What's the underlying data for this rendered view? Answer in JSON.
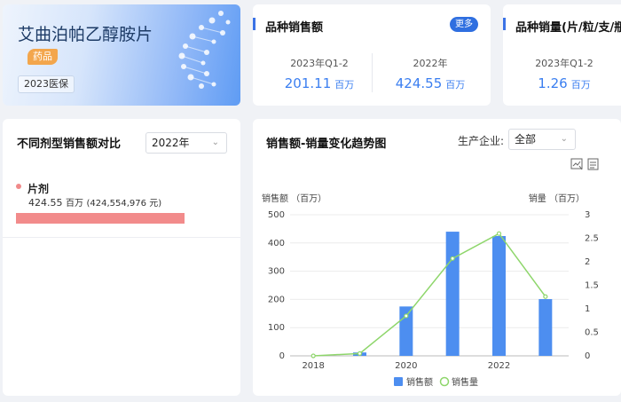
{
  "drug": {
    "name": "艾曲泊帕乙醇胺片",
    "category_tag": "药品",
    "insurance_badge": "2023医保"
  },
  "sales_card": {
    "title": "品种销售额",
    "more_label": "更多",
    "left": {
      "period": "2023年Q1-2",
      "value": "201.11",
      "unit": "百万"
    },
    "right": {
      "period": "2022年",
      "value": "424.55",
      "unit": "百万"
    }
  },
  "volume_card": {
    "title": "品种销量(片/粒/支/瓶)",
    "period": "2023年Q1-2",
    "value": "1.26",
    "unit": "百万"
  },
  "dosage_card": {
    "title": "不同剂型销售额对比",
    "year_select": "2022年",
    "items": [
      {
        "name": "片剂",
        "value": "424.55",
        "unit": "百万",
        "detail": "(424,554,976 元)",
        "share": 1.0
      }
    ],
    "colors": {
      "dot": "#f08a8a",
      "bar": "#f28b8b"
    }
  },
  "trend_card": {
    "title": "销售额-销量变化趋势图",
    "producer_label": "生产企业:",
    "producer_select": "全部",
    "icons": [
      "image-download-icon",
      "data-export-icon"
    ]
  },
  "chart_data": {
    "type": "bar+line",
    "ylabel_left": "销售额 （百万）",
    "ylabel_right": "销量 （百万）",
    "x": [
      2018,
      2019,
      2020,
      2021,
      2022,
      2023
    ],
    "x_tick_labels": [
      "2018",
      "2020",
      "2022"
    ],
    "ylim_left": [
      0,
      500
    ],
    "yticks_left": [
      0,
      100,
      200,
      300,
      400,
      500
    ],
    "ylim_right": [
      0,
      3
    ],
    "yticks_right": [
      "0",
      "0.5",
      "1",
      "1.5",
      "2",
      "2.5",
      "3"
    ],
    "series": [
      {
        "name": "销售额",
        "type": "bar",
        "color": "#4d8ef0",
        "values": [
          0,
          12,
          175,
          440,
          424.55,
          201.11
        ]
      },
      {
        "name": "销售量",
        "type": "line",
        "color": "#8ed66b",
        "values": [
          0,
          0.05,
          0.85,
          2.07,
          2.6,
          1.26
        ]
      }
    ],
    "legend_position": "bottom",
    "grid": true
  }
}
